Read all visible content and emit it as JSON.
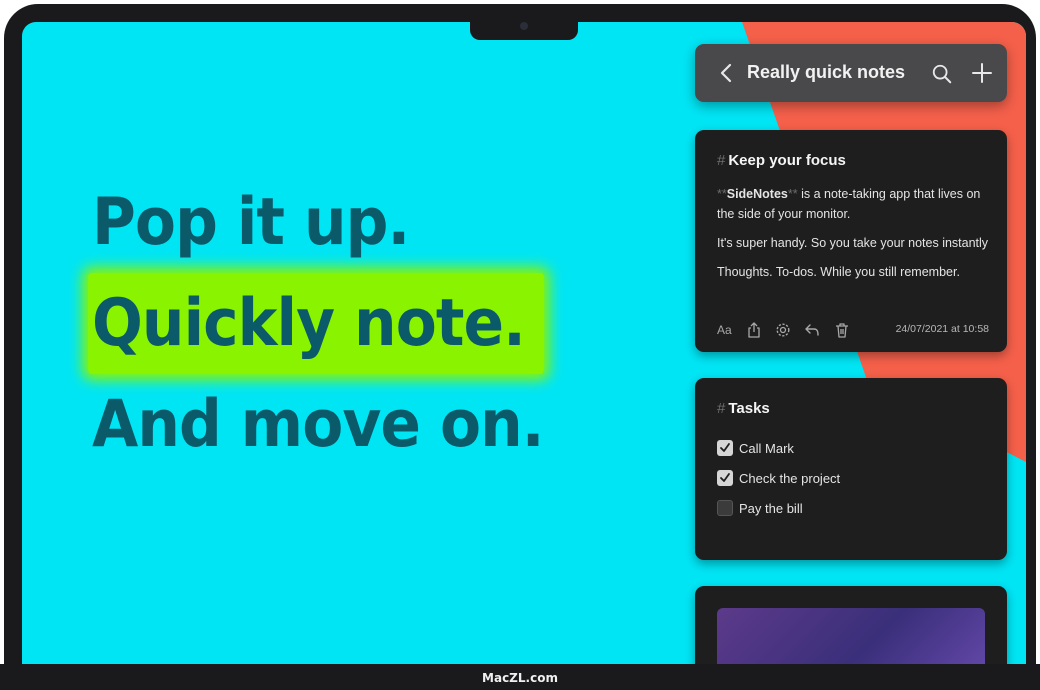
{
  "headline": {
    "line1": "Pop it up.",
    "line2": "Quickly note.",
    "line3": "And move on."
  },
  "toolbar": {
    "title": "Really quick notes",
    "back_icon": "chevron-left-icon",
    "search_icon": "search-icon",
    "add_icon": "plus-icon"
  },
  "notes": [
    {
      "hash": "#",
      "title": "Keep your focus",
      "md_open": "**",
      "app_name": "SideNotes",
      "md_close": "**",
      "line1_rest": " is a note-taking app that lives on the side of your monitor.",
      "paragraph2": "It's super handy. So you take your notes instantly",
      "paragraph3": "Thoughts. To-dos. While you still remember.",
      "font_icon_label": "Aa",
      "timestamp": "24/07/2021 at 10:58"
    },
    {
      "hash": "#",
      "title": "Tasks",
      "tasks": [
        {
          "label": "Call Mark",
          "checked": true
        },
        {
          "label": "Check the project",
          "checked": true
        },
        {
          "label": "Pay the bill",
          "checked": false
        }
      ]
    }
  ],
  "device": {
    "brand": "MacZL.com"
  },
  "colors": {
    "screen_bg": "#00e5f4",
    "headline_text": "#0b5a6a",
    "highlight": "#8af400",
    "coral": "#f5604a",
    "card_bg": "#1e1e1e",
    "toolbar_bg": "#49494c"
  }
}
